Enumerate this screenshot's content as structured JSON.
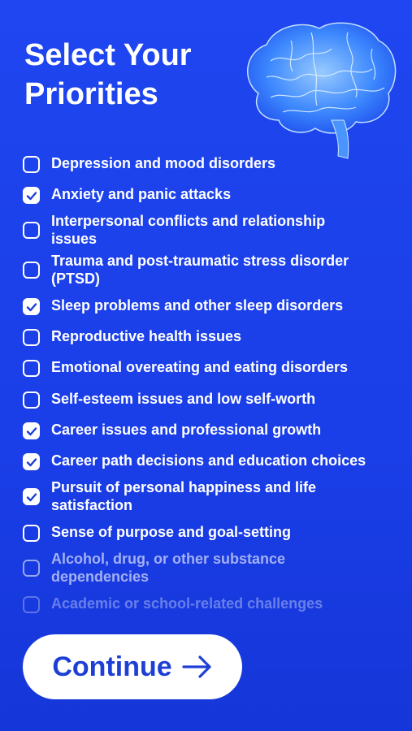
{
  "header": {
    "title_line1": "Select Your",
    "title_line2": "Priorities"
  },
  "colors": {
    "background": "#1f46f0",
    "button_bg": "#ffffff",
    "button_text": "#1d3fd6",
    "check_bg": "#ffffff"
  },
  "icons": {
    "hero": "brain-icon",
    "checkbox": "checkbox-icon",
    "check": "checkmark-icon",
    "arrow": "arrow-right-icon"
  },
  "priorities": [
    {
      "label": "Depression and mood disorders",
      "checked": false
    },
    {
      "label": "Anxiety and panic attacks",
      "checked": true
    },
    {
      "label_line1": "Interpersonal conflicts and relationship",
      "label_line2": "issues",
      "checked": false
    },
    {
      "label_line1": "Trauma and post-traumatic stress disorder",
      "label_line2": "(PTSD)",
      "checked": false
    },
    {
      "label": "Sleep problems and other sleep disorders",
      "checked": true
    },
    {
      "label": "Reproductive health issues",
      "checked": false
    },
    {
      "label": "Emotional overeating and eating disorders",
      "checked": false
    },
    {
      "label": "Self-esteem issues and low self-worth",
      "checked": false
    },
    {
      "label": "Career issues and professional growth",
      "checked": true
    },
    {
      "label": "Career path decisions and education choices",
      "checked": true
    },
    {
      "label_line1": "Pursuit of personal happiness and life",
      "label_line2": "satisfaction",
      "checked": true
    },
    {
      "label": "Sense of purpose and goal-setting",
      "checked": false
    },
    {
      "label_line1": "Alcohol, drug, or other substance",
      "label_line2": "dependencies",
      "checked": false
    },
    {
      "label": "Academic or school-related challenges",
      "checked": false
    }
  ],
  "footer": {
    "continue_label": "Continue"
  }
}
